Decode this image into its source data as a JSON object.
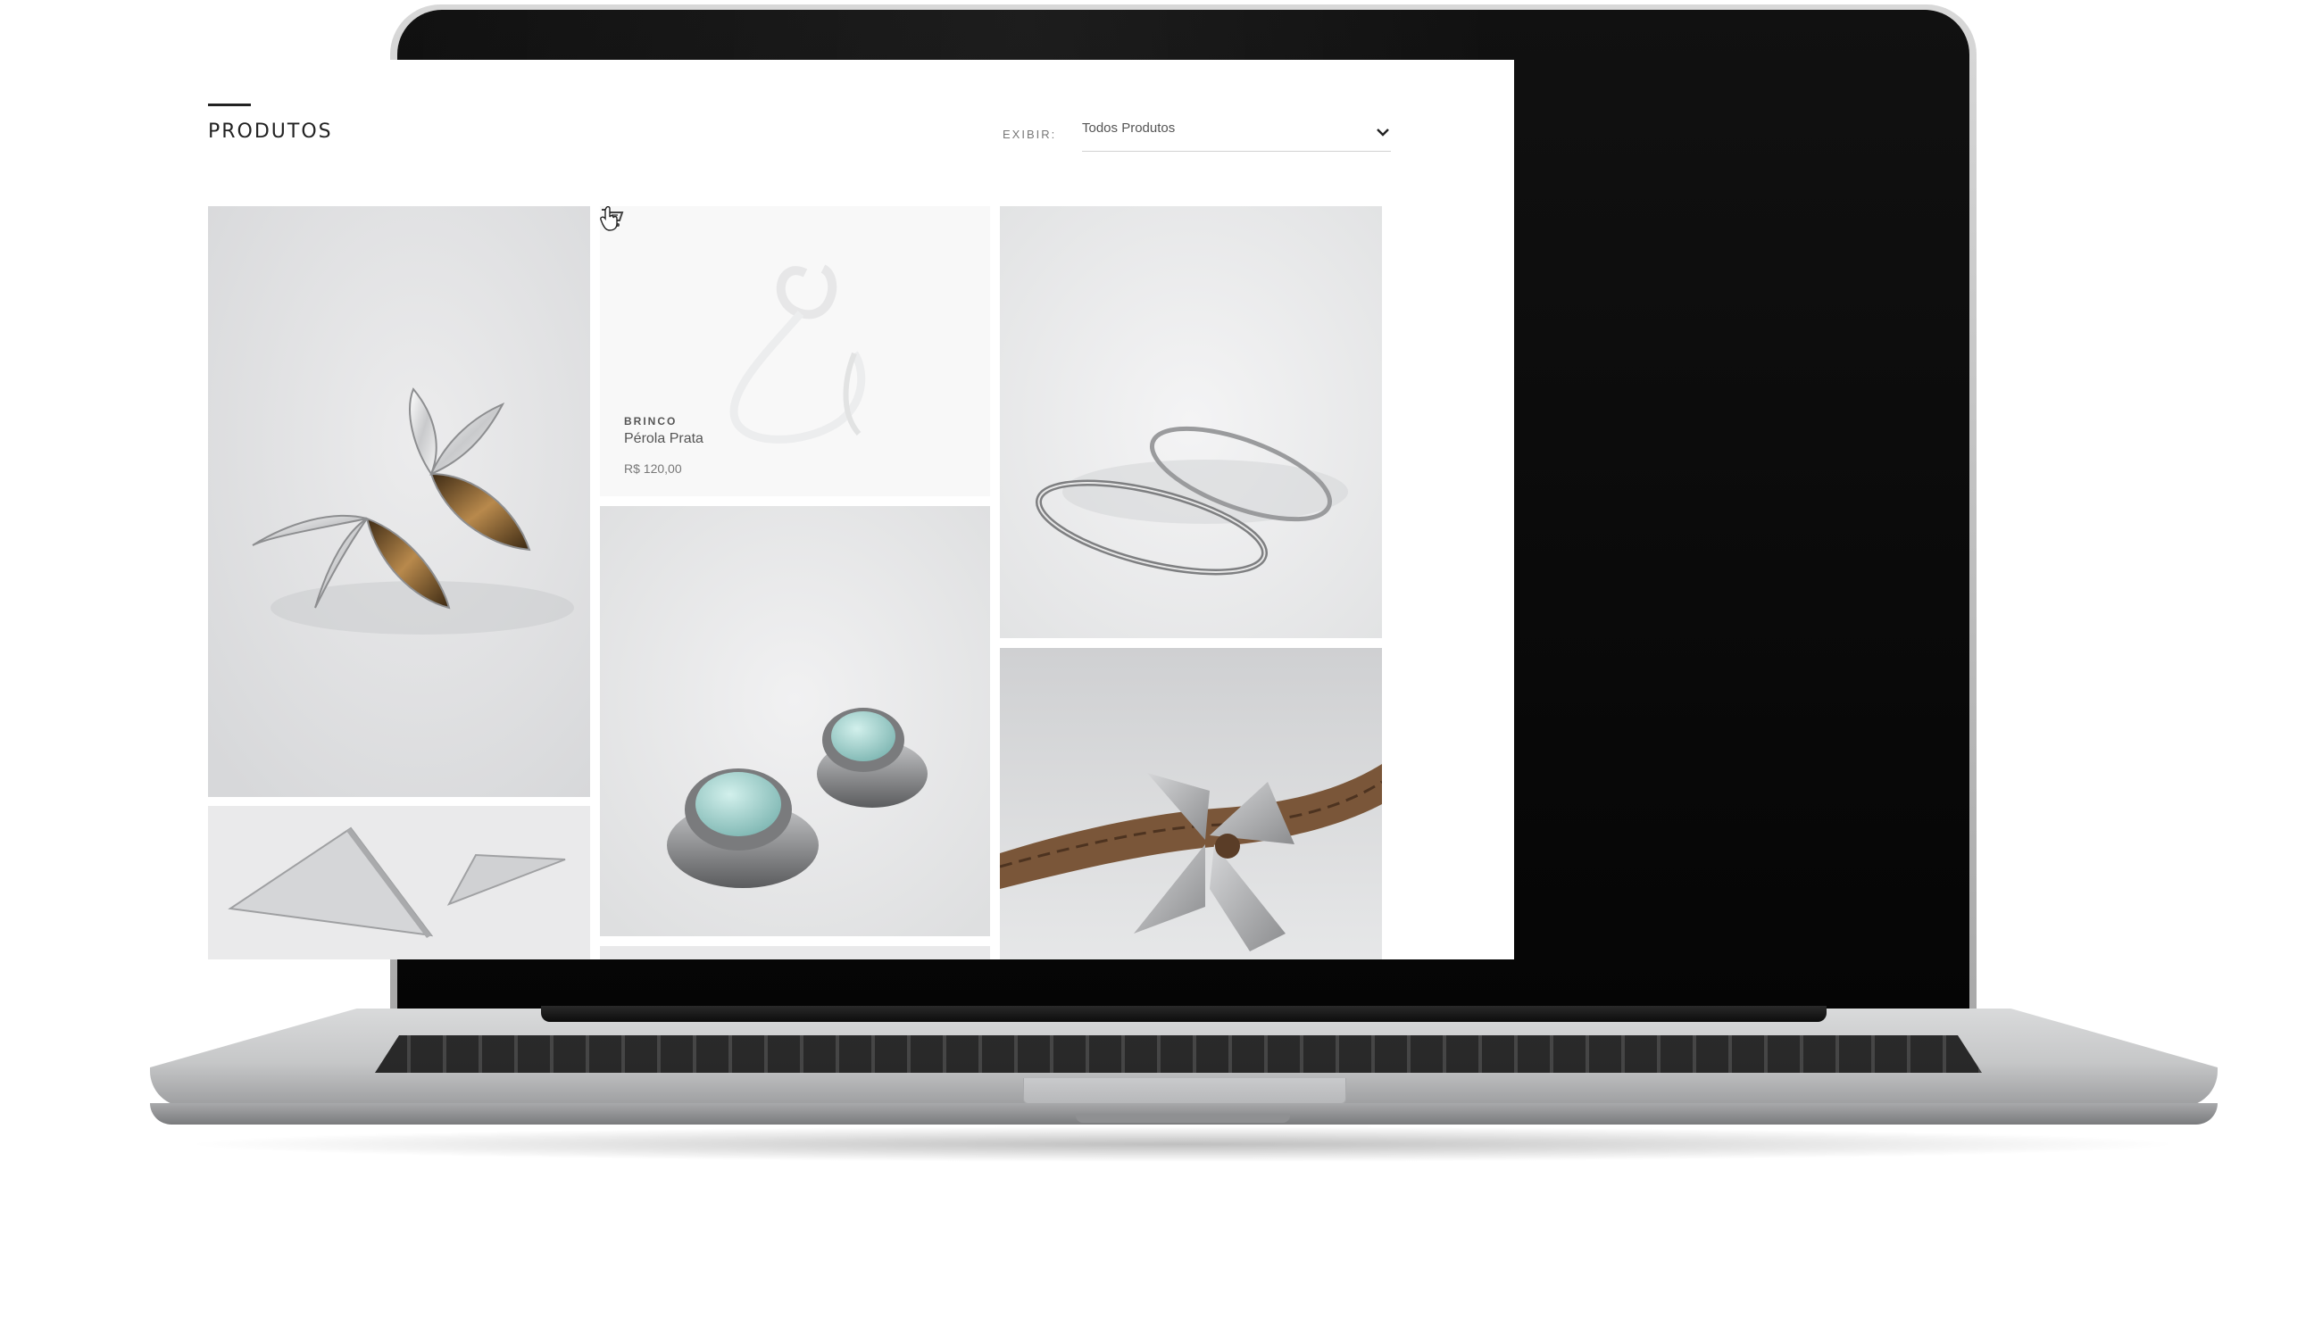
{
  "page": {
    "title": "PRODUTOS",
    "filter": {
      "label": "EXIBIR:",
      "selected": "Todos Produtos"
    }
  },
  "products": [
    {
      "id": "leaf-earrings",
      "image": "leaf-earrings-image"
    },
    {
      "id": "perola-prata-ring",
      "image": "ring-image",
      "hovered": true,
      "category": "BRINCO",
      "name": "Pérola Prata",
      "price": "R$ 120,00"
    },
    {
      "id": "bangle-bracelet",
      "image": "bangle-image"
    },
    {
      "id": "triangle-earrings",
      "image": "triangle-earrings-image"
    },
    {
      "id": "aqua-stone-earrings",
      "image": "aqua-earrings-image"
    },
    {
      "id": "leather-flower-bracelet",
      "image": "leather-bracelet-image"
    }
  ],
  "icons": {
    "dropdown": "chevron-down-icon",
    "cart": "cart-icon",
    "pointer": "hand-pointer-cursor"
  },
  "colors": {
    "text": "#222222",
    "muted": "#777777",
    "tile_bg": "#e9e9ea"
  }
}
